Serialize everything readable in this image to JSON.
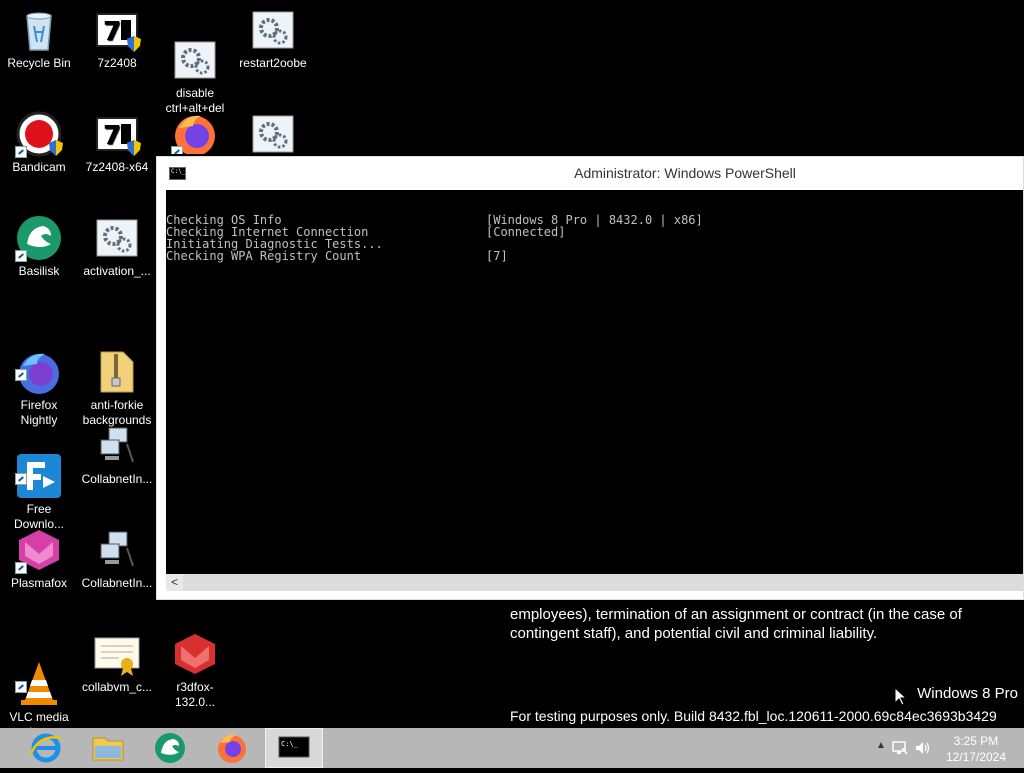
{
  "desktop": {
    "icons": [
      {
        "label": "Recycle Bin",
        "icon": "recycle-bin-icon"
      },
      {
        "label": "7z2408",
        "icon": "7zip-installer-icon"
      },
      {
        "label": "disable\nctrl+alt+del",
        "icon": "script-gear-icon"
      },
      {
        "label": "restart2oobe",
        "icon": "script-gear-icon"
      },
      {
        "label": "Bandicam",
        "icon": "bandicam-icon"
      },
      {
        "label": "7z2408-x64",
        "icon": "7zip-installer-icon"
      },
      {
        "label": "Basilisk",
        "icon": "basilisk-icon"
      },
      {
        "label": "activation_...",
        "icon": "script-gear-icon"
      },
      {
        "label": "Firefox\nNightly",
        "icon": "firefox-nightly-icon"
      },
      {
        "label": "anti-forkie\nbackgrounds",
        "icon": "zip-folder-icon"
      },
      {
        "label": "Free\nDownlo...",
        "icon": "free-download-manager-icon"
      },
      {
        "label": "CollabnetIn...",
        "icon": "network-computer-icon"
      },
      {
        "label": "Plasmafox",
        "icon": "plasmafox-icon"
      },
      {
        "label": "CollabnetIn...",
        "icon": "network-computer-icon"
      },
      {
        "label": "VLC media\nplayer",
        "icon": "vlc-icon"
      },
      {
        "label": "collabvm_c...",
        "icon": "certificate-icon"
      },
      {
        "label": "r3dfox-132.0...",
        "icon": "r3dfox-icon"
      }
    ]
  },
  "background": {
    "paragraph": "employees), termination of an assignment or contract (in the case of contingent staff), and potential civil and criminal liability.",
    "os_name": "Windows 8 Pro",
    "build": "For testing purposes only. Build 8432.fbl_loc.120611-2000.69c84ec3693b3429"
  },
  "powershell": {
    "title": "Administrator: Windows PowerShell",
    "lines": [
      {
        "key": "Checking OS Info",
        "value": "[Windows 8 Pro | 8432.0 | x86]"
      },
      {
        "key": "Checking Internet Connection",
        "value": "[Connected]"
      },
      {
        "key": "Initiating Diagnostic Tests...",
        "value": ""
      },
      {
        "key": "Checking WPA Registry Count",
        "value": "[7]"
      }
    ],
    "scroll_left": "<"
  },
  "taskbar": {
    "apps": [
      "internet-explorer-icon",
      "file-explorer-icon",
      "basilisk-icon",
      "firefox-icon",
      "powershell-icon"
    ],
    "tray_up": "▲",
    "time": "3:25 PM",
    "date": "12/17/2024"
  }
}
